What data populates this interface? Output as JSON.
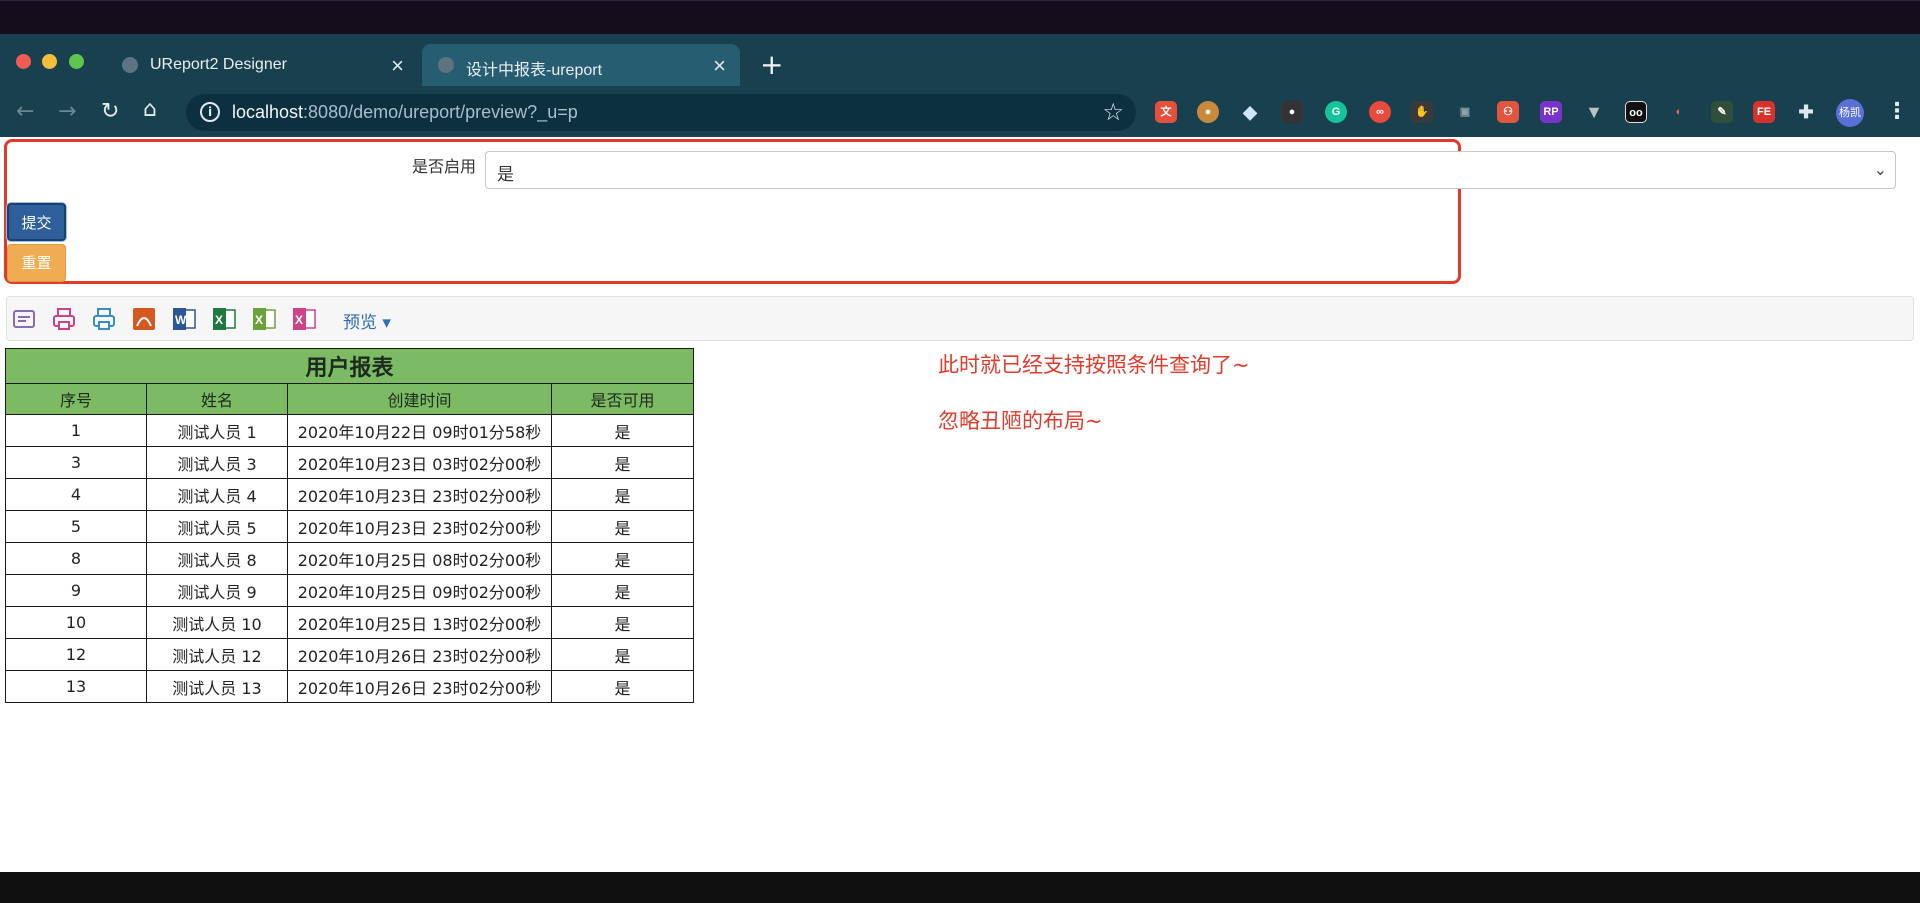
{
  "browser": {
    "tabs": [
      {
        "title": "UReport2 Designer",
        "active": false
      },
      {
        "title": "设计中报表-ureport",
        "active": true
      }
    ],
    "url_host": "localhost",
    "url_rest": ":8080/demo/ureport/preview?_u=p",
    "profile_initials": "杨凯",
    "extension_icons": [
      "translate-icon",
      "cookie-icon",
      "diamond-icon",
      "record-icon",
      "grammarly-icon",
      "infinity-icon",
      "swipe-icon",
      "screenshot-icon",
      "org-chart-icon",
      "rp-icon",
      "vue-icon",
      "face-icon",
      "color-icon",
      "pen-icon",
      "fe-icon",
      "puzzle-icon"
    ]
  },
  "form": {
    "enabled_label": "是否启用",
    "enabled_value": "是",
    "submit_label": "提交",
    "reset_label": "重置"
  },
  "toolbar": {
    "icons": [
      "print-preview-icon",
      "print-icon",
      "pdf-print-icon",
      "export-pdf-icon",
      "export-word-icon",
      "export-excel-icon",
      "export-excel-paging-icon",
      "export-excel-sheet-icon"
    ],
    "preview_label": "预览"
  },
  "report": {
    "title": "用户报表",
    "columns": [
      "序号",
      "姓名",
      "创建时间",
      "是否可用"
    ],
    "rows": [
      [
        "1",
        "测试人员 1",
        "2020年10月22日 09时01分58秒",
        "是"
      ],
      [
        "3",
        "测试人员 3",
        "2020年10月23日 03时02分00秒",
        "是"
      ],
      [
        "4",
        "测试人员 4",
        "2020年10月23日 23时02分00秒",
        "是"
      ],
      [
        "5",
        "测试人员 5",
        "2020年10月23日 23时02分00秒",
        "是"
      ],
      [
        "8",
        "测试人员 8",
        "2020年10月25日 08时02分00秒",
        "是"
      ],
      [
        "9",
        "测试人员 9",
        "2020年10月25日 09时02分00秒",
        "是"
      ],
      [
        "10",
        "测试人员 10",
        "2020年10月25日 13时02分00秒",
        "是"
      ],
      [
        "12",
        "测试人员 12",
        "2020年10月26日 23时02分00秒",
        "是"
      ],
      [
        "13",
        "测试人员 13",
        "2020年10月26日 23时02分00秒",
        "是"
      ]
    ]
  },
  "annotations": [
    "此时就已经支持按照条件查询了~",
    "忽略丑陋的布局~"
  ],
  "colors": {
    "report_header": "#7cbb63",
    "annotation": "#e33a2b",
    "highlight_box": "#e43a2c",
    "submit_button": "#2e5f9b",
    "reset_button": "#efac53"
  }
}
